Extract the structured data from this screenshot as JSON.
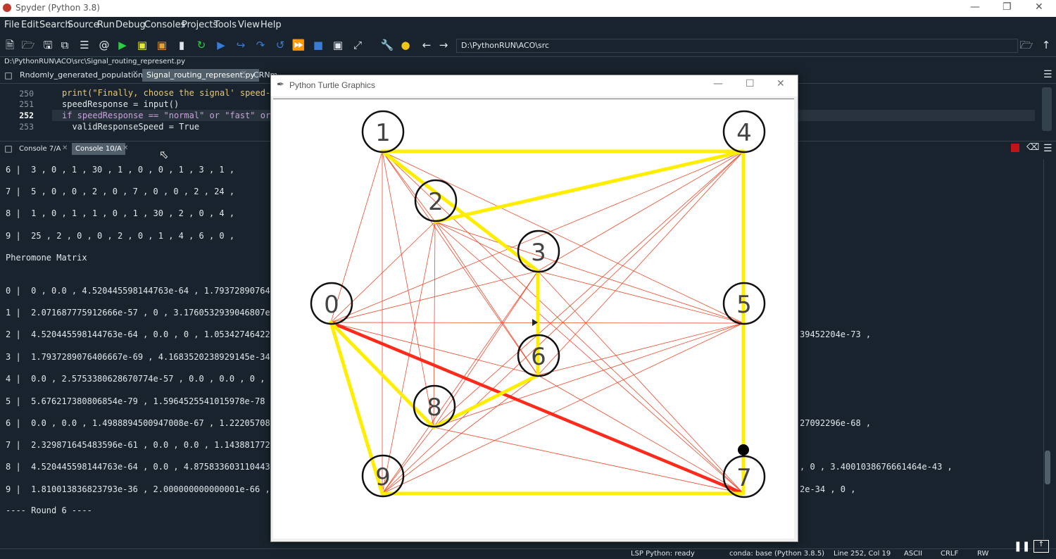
{
  "window": {
    "title": "Spyder (Python 3.8)",
    "minimize_icon": "minimize-icon",
    "maximize_icon": "restore-icon",
    "close_icon": "close-icon"
  },
  "menu": [
    "File",
    "Edit",
    "Search",
    "Source",
    "Run",
    "Debug",
    "Consoles",
    "Projects",
    "Tools",
    "View",
    "Help"
  ],
  "toolbar": {
    "path": "D:\\PythonRUN\\ACO\\src"
  },
  "file_path": "D:\\PythonRUN\\ACO\\src\\Signal_routing_represent.py",
  "editor_tabs": [
    {
      "label": "Rndomly_generated_population.py"
    },
    {
      "label": "Signal_routing_represent.py"
    },
    {
      "label": "CRNm"
    }
  ],
  "code": {
    "line_numbers": [
      "250",
      "251",
      "252",
      "253"
    ],
    "lines": [
      "print(\"Finally, choose the signal' speed-",
      "speedResponse = input()",
      "if speedResponse == \"normal\" or \"fast\" or",
      "  validResponseSpeed = True"
    ]
  },
  "console_tabs": [
    {
      "label": "Console 7/A"
    },
    {
      "label": "Console 10/A"
    }
  ],
  "console": {
    "rows_top": [
      "6 |  3 , 0 , 1 , 30 , 1 , 0 , 0 , 1 , 3 , 1 ,",
      "7 |  5 , 0 , 0 , 2 , 0 , 7 , 0 , 0 , 2 , 24 ,",
      "8 |  1 , 0 , 1 , 1 , 0 , 1 , 30 , 2 , 0 , 4 ,",
      "9 |  25 , 2 , 0 , 0 , 2 , 0 , 1 , 4 , 6 , 0 ,"
    ],
    "heading": "Pheromone Matrix",
    "rows_pher": [
      "0 |  0 , 0.0 , 4.520445598144763e-64 , 1.793728907640",
      "1 |  2.071687775912666e-57 , 0 , 3.1760532939046807e-",
      "2 |  4.520445598144763e-64 , 0.0 , 0 , 1.053427464229",
      "3 |  1.7937289076406667e-69 , 4.1683520238929145e-34",
      "4 |  0.0 , 2.5753380628670774e-57 , 0.0 , 0.0 , 0 , 3",
      "5 |  5.676217380806854e-79 , 1.5964525541015978e-78 ,",
      "6 |  0.0 , 0.0 , 1.4988894500947008e-67 , 1.222057084",
      "7 |  2.329871645483596e-61 , 0.0 , 0.0 , 1.1438817722",
      "8 |  4.520445598144763e-64 , 0.0 , 4.875833603110443e",
      "9 |  1.810013836823793e-36 , 2.000000000000001e-66 , 0"
    ],
    "right_fragments": [
      {
        "row": 2,
        "text": "39452204e-73 ,"
      },
      {
        "row": 6,
        "text": "27092296e-68 ,"
      },
      {
        "row": 8,
        "text": ", 0 , 3.4001038676661464e-43 ,"
      },
      {
        "row": 9,
        "text": "2e-34 , 0 ,"
      }
    ],
    "round": "---- Round 6 ----"
  },
  "turtle": {
    "title": "Python Turtle Graphics",
    "nodes": [
      {
        "label": "0"
      },
      {
        "label": "1"
      },
      {
        "label": "2"
      },
      {
        "label": "3"
      },
      {
        "label": "4"
      },
      {
        "label": "5"
      },
      {
        "label": "6"
      },
      {
        "label": "7"
      },
      {
        "label": "8"
      },
      {
        "label": "9"
      }
    ],
    "colors": {
      "thin_edge": "#f04a2a",
      "best_path": "#ffee00",
      "strong_edge": "#ff2a1a"
    }
  },
  "status": {
    "lsp": "LSP Python: ready",
    "conda": "conda: base (Python 3.8.5)",
    "position": "Line 252, Col 19",
    "encoding": "ASCII",
    "eol": "CRLF",
    "mode": "RW"
  }
}
